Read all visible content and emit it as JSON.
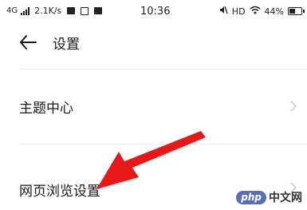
{
  "status_bar": {
    "network": "4G",
    "speed": "2.1K/s",
    "time": "10:36",
    "hd": "HD",
    "battery": "44%",
    "battery_level": 0.44
  },
  "header": {
    "title": "设置"
  },
  "list": {
    "items": [
      {
        "label": "主题中心"
      },
      {
        "label": "网页浏览设置"
      }
    ]
  },
  "annotation": {
    "arrow_color": "#e81818"
  },
  "watermark": {
    "badge": "php",
    "text": "中文网"
  }
}
